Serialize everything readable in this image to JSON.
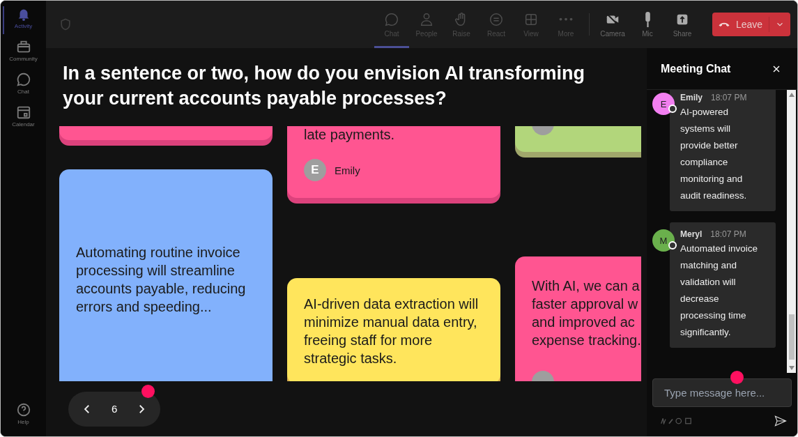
{
  "sidebar": {
    "items": [
      {
        "label": "Activity",
        "selected": true
      },
      {
        "label": "Community",
        "selected": false
      },
      {
        "label": "Chat",
        "selected": false
      },
      {
        "label": "Calendar",
        "selected": false
      }
    ],
    "help": {
      "label": "Help"
    }
  },
  "toolbar": {
    "items": [
      {
        "label": "Chat",
        "selected": true
      },
      {
        "label": "People",
        "selected": false
      },
      {
        "label": "Raise",
        "selected": false
      },
      {
        "label": "React",
        "selected": false
      },
      {
        "label": "View",
        "selected": false
      },
      {
        "label": "More",
        "selected": false
      }
    ],
    "devices": [
      {
        "label": "Camera"
      },
      {
        "label": "Mic"
      },
      {
        "label": "Share"
      }
    ],
    "leave": {
      "label": "Leave"
    }
  },
  "question": "In a sentence or two, how do you envision AI transforming your current accounts payable processes?",
  "board": {
    "columns": [
      {
        "cards": [
          {
            "color": "#ff5591"
          },
          {
            "color": "#82b1fc",
            "lines": [
              "Automating routine invoice",
              "processing will streamline",
              "accounts payable, reducing",
              "errors and speeding..."
            ]
          }
        ]
      },
      {
        "cards": [
          {
            "color": "#ff5591",
            "lines": [
              "late payments."
            ],
            "author": {
              "initial": "E",
              "name": "Emily"
            }
          },
          {
            "color": "#ffe55c",
            "lines": [
              "AI-driven data extraction will",
              "minimize manual data entry,",
              "freeing staff for more",
              "strategic tasks."
            ]
          }
        ]
      },
      {
        "cards": [
          {
            "color": "#b2d67b",
            "avatar": true
          },
          {
            "color": "#ff5591",
            "lines": [
              "With AI, we can a",
              "faster approval w",
              "and improved ac",
              "expense tracking."
            ],
            "avatar": true
          }
        ]
      }
    ]
  },
  "pagination": {
    "page": "6",
    "notification": true
  },
  "chat": {
    "title": "Meeting Chat",
    "messages": [
      {
        "initial": "E",
        "color": "#f27ff0",
        "name": "Emily",
        "time": "18:07 PM",
        "text": "AI-powered systems will provide better compliance monitoring and audit readiness."
      },
      {
        "initial": "M",
        "color": "#6ab04c",
        "name": "Meryl",
        "time": "18:07 PM",
        "text": "Automated invoice matching and validation will decrease processing time significantly."
      }
    ],
    "input": {
      "placeholder": "Type message here...",
      "notification": true
    }
  }
}
